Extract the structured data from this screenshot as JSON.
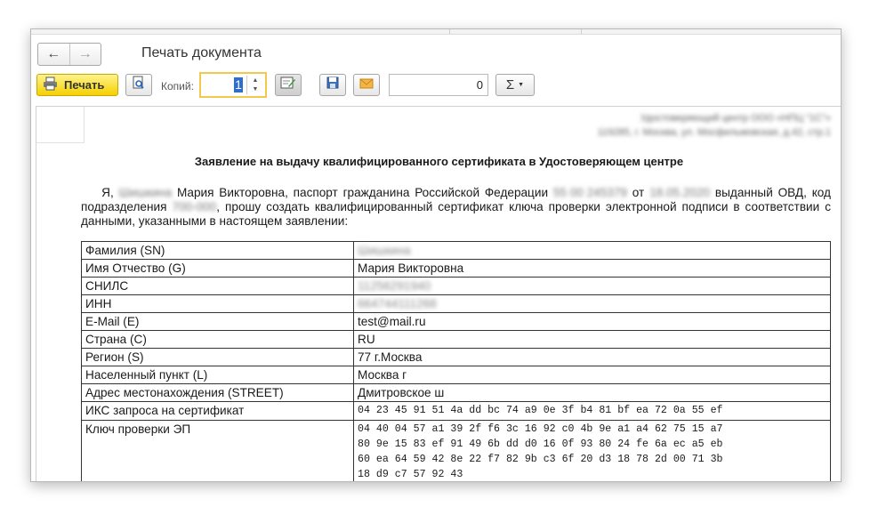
{
  "window": {
    "title": "Печать документа"
  },
  "nav": {
    "back_icon": "arrow-left-icon",
    "forward_icon": "arrow-right-icon"
  },
  "toolbar": {
    "print_label": "Печать",
    "copies_label": "Копий:",
    "copies_value": "1",
    "sum_value": "0",
    "sum_symbol": "Σ"
  },
  "header_block": {
    "ca_name": "Удостоверяющий центр ООО «НПЦ \"1С\"»",
    "ca_address": "119285, г. Москва, ул. Мосфильмовская, д.42, стр.1"
  },
  "document": {
    "title": "Заявление на выдачу квалифицированного сертификата в Удостоверяющем центре",
    "intro_1": "Я,",
    "surname_blurred": "Шишкина",
    "intro_2": "Мария Викторовна, паспорт гражданина Российской Федерации",
    "passport_blurred": "55 00 245379",
    "intro_3": "от",
    "date_blurred": "18.05.2020",
    "intro_4": "выданный ОВД, код подразделения",
    "code_blurred": "700-000",
    "intro_5": ", прошу создать квалифицированный сертификат ключа проверки электронной подписи в соответствии с данными, указанными в настоящем заявлении:"
  },
  "table": {
    "rows": [
      {
        "key": "Фамилия (SN)",
        "value": "Шишкина"
      },
      {
        "key": "Имя Отчество (G)",
        "value": "Мария Викторовна"
      },
      {
        "key": "СНИЛС",
        "value": "11256291940"
      },
      {
        "key": "ИНН",
        "value": "664744111268"
      },
      {
        "key": "E-Mail (E)",
        "value": "test@mail.ru"
      },
      {
        "key": "Страна (C)",
        "value": "RU"
      },
      {
        "key": "Регион (S)",
        "value": "77 г.Москва"
      },
      {
        "key": "Населенный пункт (L)",
        "value": "Москва г"
      },
      {
        "key": "Адрес местонахождения (STREET)",
        "value": "Дмитровское ш"
      },
      {
        "key": "ИКС запроса на сертификат",
        "value": "04 23 45 91 51 4a dd bc 74 a9 0e 3f b4 81 bf ea 72 0a 55 ef"
      },
      {
        "key": "Ключ проверки ЭП",
        "value_lines": [
          "04 40 04 57 a1 39 2f f6 3c 16 92 c0 4b 9e a1 a4 62 75 15 a7",
          "80 9e 15 83 ef 91 49 6b dd d0 16 0f 93 80 24 fe 6a ec a5 eb",
          "60 ea 64 59 42 8e 22 f7 82 9b c3 6f 20 d3 18 78 2d 00 71 3b",
          "18 d9 c7 57 92 43"
        ]
      }
    ]
  },
  "colors": {
    "print_button": "#f5d000",
    "focus_border": "#f2c94c"
  }
}
